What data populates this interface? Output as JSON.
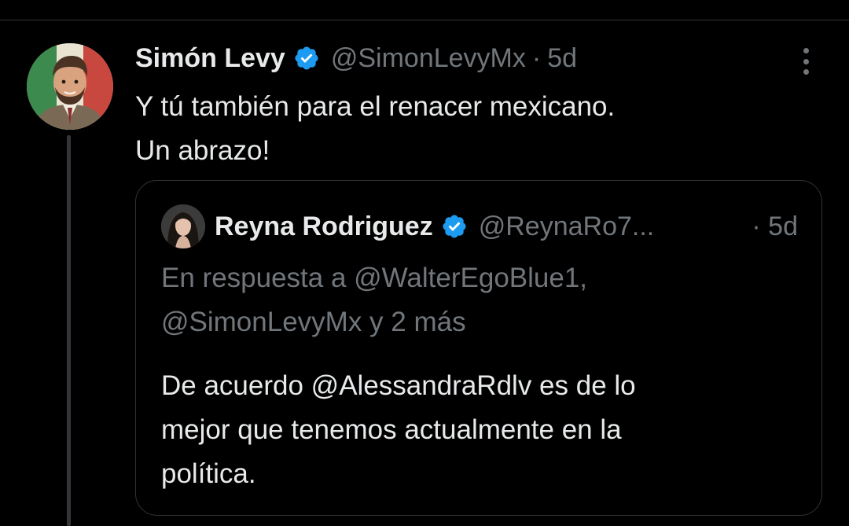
{
  "tweet": {
    "author_name": "Simón Levy",
    "author_handle": "@SimonLevyMx",
    "separator": "·",
    "time": "5d",
    "text_lines": [
      "Y tú también para el renacer mexicano.",
      "Un abrazo!"
    ]
  },
  "quoted_tweet": {
    "author_name": "Reyna Rodriguez",
    "author_handle": "@ReynaRo7...",
    "time": "· 5d",
    "reply_lines": [
      "En respuesta a @WalterEgoBlue1,",
      "@SimonLevyMx y 2 más"
    ],
    "text_lines": [
      "De acuerdo @AlessandraRdlv es de lo",
      "mejor que tenemos actualmente en la",
      "política."
    ]
  },
  "icons": {
    "verified": "verified-badge-icon",
    "more": "more-options-icon"
  },
  "colors": {
    "background": "#000000",
    "text_primary": "#e7e9ea",
    "text_secondary": "#71767b",
    "verified_blue": "#1d9bf0",
    "border": "#2f3336"
  }
}
